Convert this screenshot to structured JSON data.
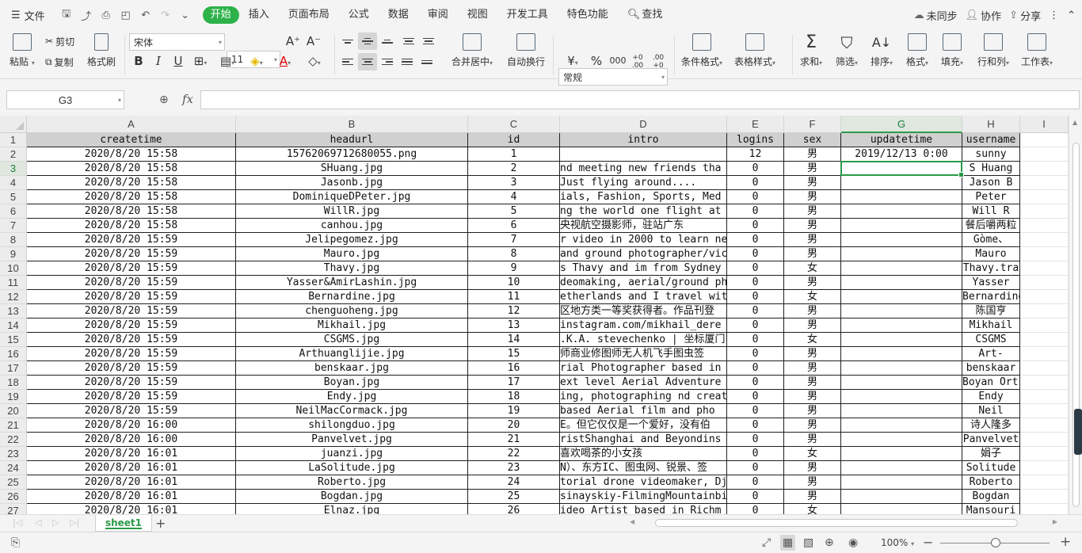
{
  "menubar": {
    "file_label": "文件",
    "tabs": [
      "开始",
      "插入",
      "页面布局",
      "公式",
      "数据",
      "审阅",
      "视图",
      "开发工具",
      "特色功能"
    ],
    "search_label": "查找",
    "sync_label": "未同步",
    "collab_label": "协作",
    "share_label": "分享"
  },
  "ribbon": {
    "paste": "粘贴",
    "cut": "剪切",
    "copy": "复制",
    "format_painter": "格式刷",
    "font_name": "宋体",
    "font_size": "11",
    "bold": "B",
    "italic": "I",
    "underline": "U",
    "font_color": "A",
    "merge_center": "合并居中",
    "auto_wrap": "自动换行",
    "number_format": "常规",
    "currency": "¥",
    "percent": "%",
    "thousands": "000",
    "dec_inc": "+0 .00",
    "dec_dec": ".00 +0",
    "conditional_format": "条件格式",
    "table_style": "表格样式",
    "sum": "求和",
    "filter": "筛选",
    "sort": "排序",
    "format": "格式",
    "fill": "填充",
    "row_col": "行和列",
    "worksheet": "工作表"
  },
  "formula_bar": {
    "name_box": "G3",
    "fx": "fx",
    "formula": ""
  },
  "sheet": {
    "col_headers": [
      "A",
      "B",
      "C",
      "D",
      "E",
      "F",
      "G",
      "H",
      "I"
    ],
    "selected_col": "G",
    "selected_row": 3,
    "header_row": [
      "createtime",
      "headurl",
      "id",
      "intro",
      "logins",
      "sex",
      "updatetime",
      "username"
    ],
    "rows": [
      [
        "2020/8/20 15:58",
        "15762069712680055.png",
        "1",
        "",
        "12",
        "男",
        "2019/12/13 0:00",
        "sunny"
      ],
      [
        "2020/8/20 15:58",
        "SHuang.jpg",
        "2",
        "nd meeting new friends tha",
        "0",
        "男",
        "",
        "S Huang"
      ],
      [
        "2020/8/20 15:58",
        "Jasonb.jpg",
        "3",
        " Just flying around....",
        "0",
        "男",
        "",
        "Jason B"
      ],
      [
        "2020/8/20 15:58",
        "DominiqueDPeter.jpg",
        "4",
        "ials, Fashion, Sports, Med",
        "0",
        "男",
        "",
        "Peter"
      ],
      [
        "2020/8/20 15:58",
        "WillR.jpg",
        "5",
        "ng the world one flight at",
        "0",
        "男",
        "",
        "Will R"
      ],
      [
        "2020/8/20 15:58",
        "canhou.jpg",
        "6",
        "  央视航空摄影师，驻站广东",
        "0",
        "男",
        "",
        "餐后嚼两粒"
      ],
      [
        "2020/8/20 15:59",
        "Jelipegomez.jpg",
        "7",
        "r video in 2000 to learn ne",
        "0",
        "男",
        "",
        "Gòme、"
      ],
      [
        "2020/8/20 15:59",
        "Mauro.jpg",
        "8",
        "and ground photographer/vic",
        "0",
        "男",
        "",
        "Mauro"
      ],
      [
        "2020/8/20 15:59",
        "Thavy.jpg",
        "9",
        "s Thavy and im from Sydney",
        "0",
        "女",
        "",
        "Thavy.tra"
      ],
      [
        "2020/8/20 15:59",
        "Yasser&AmirLashin.jpg",
        "10",
        "deomaking, aerial/ground ph",
        "0",
        "男",
        "",
        "Yasser"
      ],
      [
        "2020/8/20 15:59",
        "Bernardine.jpg",
        "11",
        "etherlands and I travel wit",
        "0",
        "女",
        "",
        "Bernardine"
      ],
      [
        "2020/8/20 15:59",
        "chenguoheng.jpg",
        "12",
        "区地方类一等奖获得者。作品刊登",
        "0",
        "男",
        "",
        "陈国亨"
      ],
      [
        "2020/8/20 15:59",
        "Mikhail.jpg",
        "13",
        "instagram.com/mikhail_dere",
        "0",
        "男",
        "",
        "Mikhail"
      ],
      [
        "2020/8/20 15:59",
        "CSGMS.jpg",
        "14",
        ".K.A. stevechenko | 坐标厦门",
        "0",
        "女",
        "",
        "CSGMS"
      ],
      [
        "2020/8/20 15:59",
        "Arthuanglijie.jpg",
        "15",
        "师商业修图师无人机飞手图虫签",
        "0",
        "男",
        "",
        "Art-"
      ],
      [
        "2020/8/20 15:59",
        "benskaar.jpg",
        "16",
        "rial Photographer based in",
        "0",
        "男",
        "",
        "benskaar"
      ],
      [
        "2020/8/20 15:59",
        "Boyan.jpg",
        "17",
        "ext level Aerial Adventure",
        "0",
        "男",
        "",
        "Boyan Ortse"
      ],
      [
        "2020/8/20 15:59",
        "Endy.jpg",
        "18",
        "ing, photographing nd creat",
        "0",
        "男",
        "",
        "Endy"
      ],
      [
        "2020/8/20 15:59",
        "NeilMacCormack.jpg",
        "19",
        " based Aerial film and pho",
        "0",
        "男",
        "",
        "Neil"
      ],
      [
        "2020/8/20 16:00",
        "shilongduo.jpg",
        "20",
        "E。但它仅仅是一个爱好，没有伯",
        "0",
        "男",
        "",
        "诗人隆多"
      ],
      [
        "2020/8/20 16:00",
        "Panvelvet.jpg",
        "21",
        "ristShanghai and Beyondins",
        "0",
        "男",
        "",
        "Panvelvet"
      ],
      [
        "2020/8/20 16:01",
        "juanzi.jpg",
        "22",
        "  喜欢喝茶的小女孩",
        "0",
        "女",
        "",
        "娟子"
      ],
      [
        "2020/8/20 16:01",
        "LaSolitude.jpg",
        "23",
        "N）、东方IC、图虫网、锐景、签",
        "0",
        "男",
        "",
        "Solitude"
      ],
      [
        "2020/8/20 16:01",
        "Roberto.jpg",
        "24",
        "torial drone videomaker, Dj",
        "0",
        "男",
        "",
        "Roberto"
      ],
      [
        "2020/8/20 16:01",
        "Bogdan.jpg",
        "25",
        "sinayskiy-FilmingMountainbi",
        "0",
        "男",
        "",
        "Bogdan"
      ],
      [
        "2020/8/20 16:01",
        "Elnaz.jpg",
        "26",
        "ideo Artist based in Richm",
        "0",
        "女",
        "",
        "Mansouri"
      ]
    ]
  },
  "tabbar": {
    "sheet_name": "sheet1",
    "add": "+"
  },
  "statusbar": {
    "zoom": "100%",
    "zoom_minus": "−",
    "zoom_plus": "+"
  },
  "colors": {
    "accent": "#2db24a",
    "selection": "#2b9a48",
    "header_fill": "#d0d0d0"
  }
}
